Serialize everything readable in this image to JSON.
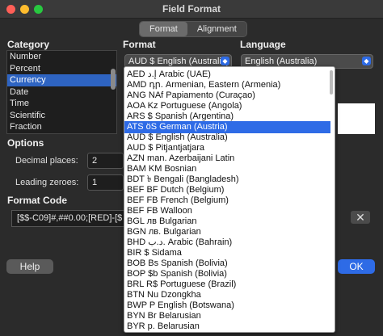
{
  "window": {
    "title": "Field Format"
  },
  "tabs": [
    {
      "label": "Format",
      "active": true
    },
    {
      "label": "Alignment",
      "active": false
    }
  ],
  "category": {
    "header": "Category",
    "items": [
      "Number",
      "Percent",
      "Currency",
      "Date",
      "Time",
      "Scientific",
      "Fraction"
    ],
    "selected": "Currency"
  },
  "format": {
    "header": "Format",
    "current": "AUD  $  English (Australia)"
  },
  "language": {
    "header": "Language",
    "current": "English (Australia)"
  },
  "options": {
    "header": "Options",
    "decimal_label": "Decimal places:",
    "decimal_value": "2",
    "leading_label": "Leading zeroes:",
    "leading_value": "1"
  },
  "format_code": {
    "header": "Format Code",
    "value": "[$$-C09]#,##0.00;[RED]-[$"
  },
  "buttons": {
    "help": "Help",
    "ok": "OK",
    "delete": "✕"
  },
  "dropdown": {
    "selected_index": 5,
    "items": [
      "AED  إ.د  Arabic (UAE)",
      "AMD  դր.  Armenian, Eastern (Armenia)",
      "ANG  NAf  Papiamento (Curaçao)",
      "AOA  Kz  Portuguese (Angola)",
      "ARS  $  Spanish (Argentina)",
      "ATS  öS  German (Austria)",
      "AUD  $  English (Australia)",
      "AUD  $  Pitjantjatjara",
      "AZN  man.  Azerbaijani Latin",
      "BAM  KM  Bosnian",
      "BDT  ৳  Bengali (Bangladesh)",
      "BEF  BF  Dutch (Belgium)",
      "BEF  FB  French (Belgium)",
      "BEF  FB  Walloon",
      "BGL  лв  Bulgarian",
      "BGN  лв.  Bulgarian",
      "BHD  د.ب.  Arabic (Bahrain)",
      "BIR  $  Sidama",
      "BOB  Bs  Spanish (Bolivia)",
      "BOP  $b  Spanish (Bolivia)",
      "BRL  R$  Portuguese (Brazil)",
      "BTN  Nu  Dzongkha",
      "BWP  P  English (Botswana)",
      "BYN  Br  Belarusian",
      "BYR  p.  Belarusian"
    ]
  },
  "colors": {
    "accent": "#2e6be6",
    "selection": "#2e64c2",
    "dialog_bg": "#2b2b2b"
  }
}
